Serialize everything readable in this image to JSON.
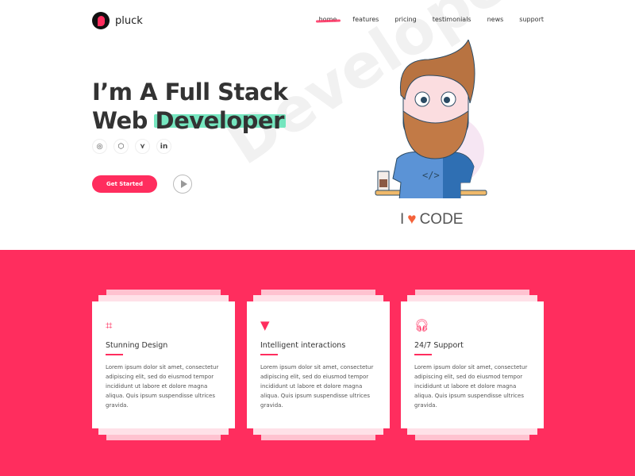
{
  "brand": {
    "name": "pluck"
  },
  "nav": {
    "items": [
      "home",
      "features",
      "pricing",
      "testimonials",
      "news",
      "support"
    ],
    "active": "home"
  },
  "hero": {
    "title_line1": "I’m A Full Stack",
    "title_line2_a": "Web",
    "title_line2_b": "Developer",
    "watermark": "Developer",
    "socials": [
      {
        "icon": "github-icon",
        "glyph": "◎"
      },
      {
        "icon": "codepen-icon",
        "glyph": "⬡"
      },
      {
        "icon": "gitlab-icon",
        "glyph": "⋎"
      },
      {
        "icon": "linkedin-icon",
        "glyph": "in"
      }
    ],
    "cta": "Get Started",
    "illustration_caption_a": "I",
    "illustration_caption_b": "CODE"
  },
  "colors": {
    "accent": "#ff2d5e",
    "highlight": "#5ee3b5"
  },
  "features": [
    {
      "icon": "flow-icon",
      "glyph": "⌗",
      "title": "Stunning Design",
      "text": "Lorem ipsum dolor sit amet, consectetur adipiscing elit, sed do eiusmod tempor incididunt ut labore et dolore magna aliqua. Quis ipsum suspendisse ultrices gravida."
    },
    {
      "icon": "funnel-icon",
      "glyph": "▼",
      "title": "Intelligent interactions",
      "text": "Lorem ipsum dolor sit amet, consectetur adipiscing elit, sed do eiusmod tempor incididunt ut labore et dolore magna aliqua. Quis ipsum suspendisse ultrices gravida."
    },
    {
      "icon": "headphones-icon",
      "glyph": "🎧︎",
      "title": "24/7 Support",
      "text": "Lorem ipsum dolor sit amet, consectetur adipiscing elit, sed do eiusmod tempor incididunt ut labore et dolore magna aliqua. Quis ipsum suspendisse ultrices gravida."
    }
  ]
}
